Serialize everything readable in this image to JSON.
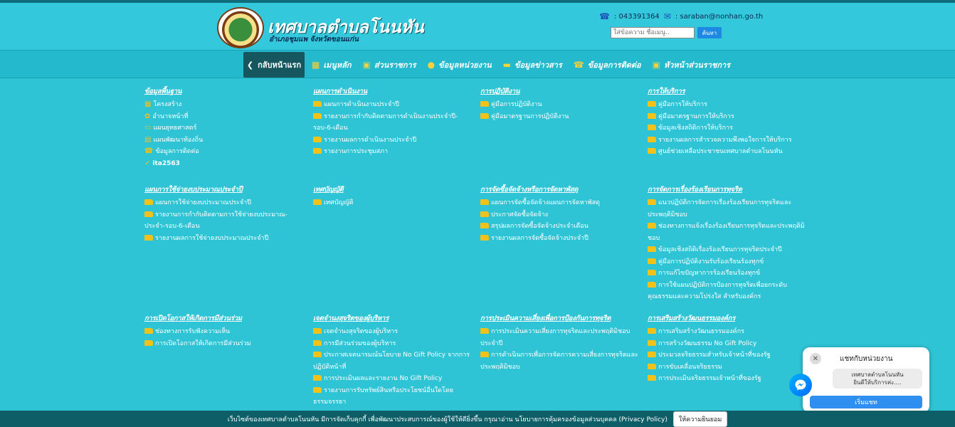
{
  "header": {
    "title": "เทศบาลตำบลโนนหัน",
    "subtitle": "อำเภอชุมแพ จังหวัดขอนแก่น",
    "phone": ": 043391364",
    "email": ": saraban@nonhan.go.th",
    "search_placeholder": "ใส่ข้อความ ชื่อเมนู..",
    "search_button": "ค้นหา"
  },
  "nav": {
    "back": "กลับหน้าแรก",
    "items": [
      {
        "label": "เมนูหลัก",
        "icon": "grid-icon"
      },
      {
        "label": "ส่วนราชการ",
        "icon": "calendar-icon"
      },
      {
        "label": "ข้อมูลหน่วยงาน",
        "icon": "info-icon"
      },
      {
        "label": "ข้อมูลข่าวสาร",
        "icon": "news-icon"
      },
      {
        "label": "ข้อมูลการติดต่อ",
        "icon": "phone-icon"
      },
      {
        "label": "หัวหน้าส่วนราชการ",
        "icon": "user-icon"
      }
    ]
  },
  "sections": [
    {
      "title": "ข้อมูลพื้นฐาน",
      "items": [
        {
          "label": "โครงสร้าง",
          "icon": "structure-icon"
        },
        {
          "label": "อำนาจหน้าที่",
          "icon": "authority-icon"
        },
        {
          "label": "แผนยุทธศาสตร์",
          "icon": "laptop-icon"
        },
        {
          "label": "แผนพัฒนาท้องถิ่น",
          "icon": "calendar-icon"
        },
        {
          "label": "ข้อมูลการติดต่อ",
          "icon": "phone-icon"
        },
        {
          "label": "ita2563",
          "icon": "check-icon"
        }
      ]
    },
    {
      "title": "แผนการดำเนินงาน",
      "items": [
        {
          "label": "แผนการดำเนินงานประจำปี",
          "icon": "folder-icon"
        },
        {
          "label": "รายงานการกำกับติดตามการดำเนินงานประจำปี-รอบ-6-เดือน",
          "icon": "folder-icon"
        },
        {
          "label": "รายงานผลการดำเนินงานประจำปี",
          "icon": "folder-icon"
        },
        {
          "label": "รายงานการประชุมสภา",
          "icon": "folder-icon"
        }
      ]
    },
    {
      "title": "การปฏิบัติงาน",
      "items": [
        {
          "label": "คู่มือการปฏิบัติงาน",
          "icon": "folder-icon"
        },
        {
          "label": "คู่มือมาตรฐานการปฏิบัติงาน",
          "icon": "folder-icon"
        }
      ]
    },
    {
      "title": "การให้บริการ",
      "items": [
        {
          "label": "คู่มือการให้บริการ",
          "icon": "folder-icon"
        },
        {
          "label": "คู่มือมาตรฐานการให้บริการ",
          "icon": "folder-icon"
        },
        {
          "label": "ข้อมูลเชิงสถิติการให้บริการ",
          "icon": "folder-icon"
        },
        {
          "label": "รายงานผลการสำรวจความพึงพอใจการให้บริการ",
          "icon": "folder-icon"
        },
        {
          "label": "ศูนย์ช่วยเหลือประชาชนเทศบาลตำบลโนนหัน",
          "icon": "folder-icon"
        }
      ]
    },
    {
      "title": "แผนการใช้จ่ายงบประมาณประจำปี",
      "items": [
        {
          "label": "แผนการใช้จ่ายงบประมาณประจำปี",
          "icon": "folder-icon"
        },
        {
          "label": "รายงานการกำกับติดตามการใช้จ่ายงบประมาณ-ประจำ-รอบ-6-เดือน",
          "icon": "folder-icon"
        },
        {
          "label": "รายงานผลการใช้จ่ายงบประมาณประจำปี",
          "icon": "folder-icon"
        }
      ]
    },
    {
      "title": "เทศบัญญัติ",
      "items": [
        {
          "label": "เทศบัญญัติ",
          "icon": "folder-icon"
        }
      ]
    },
    {
      "title": "การจัดซื้อจัดจ้างหรือการจัดหาพัสดุ",
      "items": [
        {
          "label": "แผนการจัดซื้อจัดจ้างแผนการจัดหาพัสดุ",
          "icon": "folder-icon"
        },
        {
          "label": "ประกาศจัดซื้อจัดจ้าง",
          "icon": "folder-icon"
        },
        {
          "label": "สรุปผลการจัดซื้อจัดจ้างประจำเดือน",
          "icon": "folder-icon"
        },
        {
          "label": "รายงานผลการจัดซื้อจัดจ้างประจำปี",
          "icon": "folder-icon"
        }
      ]
    },
    {
      "title": "การจัดการเรื่องร้องเรียนการทุจริต",
      "items": [
        {
          "label": "แนวปฏิบัติการจัดการเรื่องร้องเรียนการทุจริตและประพฤติมิชอบ",
          "icon": "folder-icon"
        },
        {
          "label": "ช่องทางการแจ้งเรื่องร้องเรียนการทุจริตและประพฤติมิชอบ",
          "icon": "folder-icon"
        },
        {
          "label": "ข้อมูลเชิงสถิติเรื่องร้องเรียนการทุจริตประจำปี",
          "icon": "folder-icon"
        },
        {
          "label": "คู่มือการปฏิบัติงานรับร้องเรียนร้องทุกข์",
          "icon": "folder-icon"
        },
        {
          "label": "การแก้ไขปัญหาการร้องเรียนร้องทุกข์",
          "icon": "folder-icon"
        },
        {
          "label": "การใช้แผนปฏิบัติการป้องการทุจริตเพื่อยกระดับคุณธรรมและความโปร่งใส สำหรับองค์กร",
          "icon": "folder-icon"
        }
      ]
    },
    {
      "title": "การเปิดโอกาสให้เกิดการมีส่วนร่วม",
      "items": [
        {
          "label": "ช่องทางการรับฟังความเห็น",
          "icon": "folder-icon"
        },
        {
          "label": "การเปิดโอกาสให้เกิดการมีส่วนร่วม",
          "icon": "folder-icon"
        }
      ]
    },
    {
      "title": "เจตจำนงสุจริตของผู้บริหาร",
      "items": [
        {
          "label": "เจตจำนงสุจริตของผู้บริหาร",
          "icon": "folder-icon"
        },
        {
          "label": "การมีส่วนร่วมของผู้บริหาร",
          "icon": "folder-icon"
        },
        {
          "label": "ประกาศเจตนารมณ์นโยบาย No Gift Policy จากการปฏิบัติหน้าที่",
          "icon": "folder-icon"
        },
        {
          "label": "การประเมินผลและรายงาน No Gift Policy",
          "icon": "folder-icon"
        },
        {
          "label": "รายงานการรับทรัพย์สินหรือประโยชน์อื่นใดโดยธรรมจรรยา",
          "icon": "folder-icon"
        }
      ]
    },
    {
      "title": "การประเมินความเสี่ยงเพื่อการป้องกันการทุจริต",
      "items": [
        {
          "label": "การประเมินความเสี่ยงการทุจริตและประพฤติมิชอบประจำปี",
          "icon": "folder-icon"
        },
        {
          "label": "การดำเนินการเพื่อการจัดการความเสี่ยงการทุจริตและประพฤติมิชอบ",
          "icon": "folder-icon"
        }
      ]
    },
    {
      "title": "การเสริมสร้างวัฒนธรรมองค์กร",
      "items": [
        {
          "label": "การเสริมสร้างวัฒนธรรมองค์กร",
          "icon": "folder-icon"
        },
        {
          "label": "การสร้างวัฒนธรรม No Gift Policy",
          "icon": "folder-icon"
        },
        {
          "label": "ประมวลจริยธรรมสำหรับเจ้าหน้าที่ของรัฐ",
          "icon": "folder-icon"
        },
        {
          "label": "การขับเคลื่อนจริยธรรม",
          "icon": "folder-icon"
        },
        {
          "label": "การประเมินจริยธรรมเจ้าหน้าที่ของรัฐ",
          "icon": "folder-icon"
        }
      ]
    }
  ],
  "footer": {
    "text": "เว็บไซต์ของเทศบาลตำบลโนนหัน มีการจัดเก็บคุกกี้ เพื่อพัฒนาประสบการณ์ของผู้ใช้ให้ดียิ่งขึ้น กรุณาอ่าน นโยบายการคุ้มครองข้อมูลส่วนบุคคล (Privacy Policy)",
    "consent": "ให้ความยินยอม"
  },
  "chat": {
    "title": "แชทกับหน่วยงาน",
    "message_line1": "เทศบาลตำบลโนนหัน",
    "message_line2": "ยินดีให้บริการค่ะ....",
    "start": "เริ่มแชท"
  },
  "colors": {
    "background": "#2ec4d6",
    "folder": "#f2c21b",
    "footer": "#0e5e68"
  }
}
